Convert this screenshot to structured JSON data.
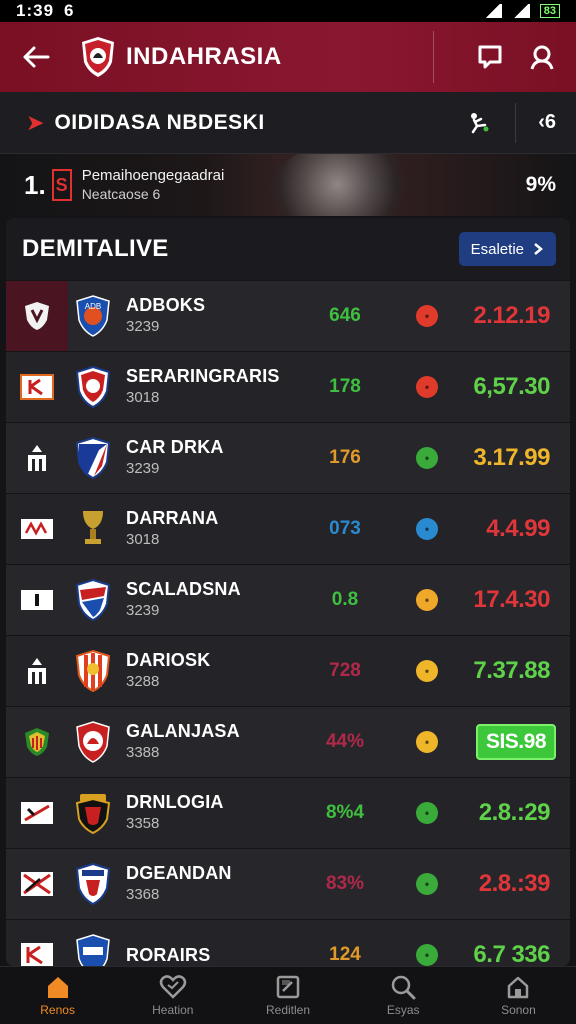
{
  "status_bar": {
    "time": "1:39",
    "time_extra": "6",
    "battery": "83"
  },
  "app_bar": {
    "title": "INDAHRASIA"
  },
  "sub_bar": {
    "title": "OIDIDASA NBDESKI",
    "count": "6"
  },
  "banner": {
    "rank": "1.",
    "badge": "S",
    "line1": "Pemaihoengegaadrai",
    "line2": "Neatcaose 6",
    "percent": "9%"
  },
  "panel": {
    "title": "DEMITALIVE",
    "button_label": "Esaletie"
  },
  "rows": [
    {
      "name": "ADBOKS",
      "sub": "3239",
      "form": "646",
      "form_color": "#3fbf3f",
      "dot_color": "#e03a2a",
      "odds": "2.12.19",
      "odds_color": "#e0363a",
      "boxed": false
    },
    {
      "name": "SERARINGRARIS",
      "sub": "3018",
      "form": "178",
      "form_color": "#3fbf3f",
      "dot_color": "#e03a2a",
      "odds": "6,57.30",
      "odds_color": "#5fd24a",
      "boxed": false
    },
    {
      "name": "CAR DRKA",
      "sub": "3239",
      "form": "176",
      "form_color": "#e09a2a",
      "dot_color": "#3aaa3a",
      "odds": "3.17.99",
      "odds_color": "#f0b62a",
      "boxed": false
    },
    {
      "name": "DARRANA",
      "sub": "3018",
      "form": "073",
      "form_color": "#2a8ad0",
      "dot_color": "#2a8ad0",
      "odds": "4.4.99",
      "odds_color": "#e0363a",
      "boxed": false
    },
    {
      "name": "SCALADSNA",
      "sub": "3239",
      "form": "0.8",
      "form_color": "#3fbf3f",
      "dot_color": "#f0a82a",
      "odds": "17.4.30",
      "odds_color": "#e0363a",
      "boxed": false
    },
    {
      "name": "DARIOSK",
      "sub": "3288",
      "form": "728",
      "form_color": "#b0284a",
      "dot_color": "#f0b62a",
      "odds": "7.37.88",
      "odds_color": "#5fd24a",
      "boxed": false
    },
    {
      "name": "GALANJASA",
      "sub": "3388",
      "form": "44%",
      "form_color": "#b0284a",
      "dot_color": "#f0b62a",
      "odds": "SIS.98",
      "odds_color": "#ffffff",
      "boxed": true
    },
    {
      "name": "DRNLOGIA",
      "sub": "3358",
      "form": "8%4",
      "form_color": "#3fbf3f",
      "dot_color": "#3aaa3a",
      "odds": "2.8.:29",
      "odds_color": "#5fd24a",
      "boxed": false
    },
    {
      "name": "DGEANDAN",
      "sub": "3368",
      "form": "83%",
      "form_color": "#b0284a",
      "dot_color": "#3aaa3a",
      "odds": "2.8.:39",
      "odds_color": "#e0363a",
      "boxed": false
    },
    {
      "name": "RORAIRS",
      "sub": "",
      "form": "124",
      "form_color": "#e09a2a",
      "dot_color": "#3aaa3a",
      "odds": "6.7 336",
      "odds_color": "#5fd24a",
      "boxed": false
    }
  ],
  "nav": [
    {
      "label": "Renos",
      "icon": "home-icon"
    },
    {
      "label": "Heation",
      "icon": "heart-icon"
    },
    {
      "label": "Reditlen",
      "icon": "document-icon"
    },
    {
      "label": "Esyas",
      "icon": "search-icon"
    },
    {
      "label": "Sonon",
      "icon": "house-icon"
    }
  ],
  "colors": {
    "accent": "#8a1730",
    "active_nav": "#f08a24",
    "button": "#1f3d80"
  }
}
